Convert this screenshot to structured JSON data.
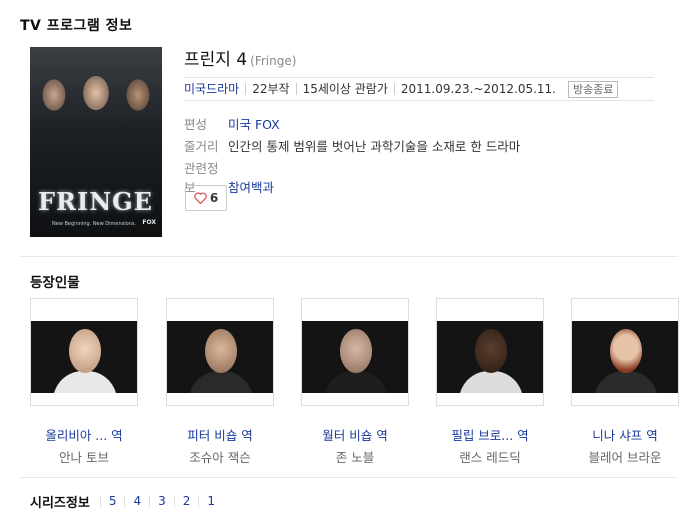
{
  "header": {
    "title": "TV 프로그램 정보"
  },
  "poster": {
    "title": "FRINGE",
    "tagline": "New Beginning. New Dimensions.",
    "network": "FOX"
  },
  "show": {
    "title": "프린지 4",
    "original_title": "(Fringe)",
    "meta": {
      "genre": "미국드라마",
      "episodes": "22부작",
      "rating": "15세이상 관람가",
      "period": "2011.09.23.~2012.05.11.",
      "status_badge": "방송종료"
    },
    "channel_label": "편성",
    "channel": "미국 FOX",
    "synopsis_label": "줄거리",
    "synopsis": "인간의 통제 범위를 벗어난 과학기술을 소재로 한 드라마",
    "related_label": "관련정보",
    "related_link": "참여백과",
    "likes": "6"
  },
  "cast_section": {
    "title": "등장인물",
    "members": [
      {
        "role": "올리비아 ... 역",
        "actor": "안나 토브"
      },
      {
        "role": "피터 비숍 역",
        "actor": "조슈아 잭슨"
      },
      {
        "role": "월터 비숍 역",
        "actor": "존 노블"
      },
      {
        "role": "필립 브로... 역",
        "actor": "랜스 레드딕"
      },
      {
        "role": "니나 샤프 역",
        "actor": "블레어 브라운"
      }
    ]
  },
  "series_section": {
    "title": "시리즈정보",
    "seasons": [
      "5",
      "4",
      "3",
      "2",
      "1"
    ]
  },
  "colors": {
    "link": "#1a3a9c",
    "heart": "#d9534f"
  }
}
